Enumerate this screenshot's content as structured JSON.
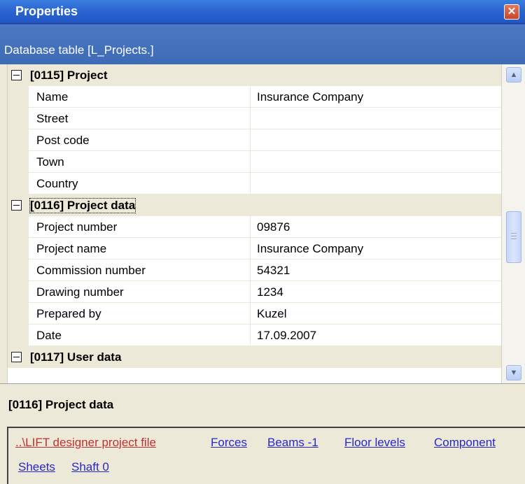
{
  "window": {
    "title": "Properties",
    "close_icon": "close-icon"
  },
  "header": {
    "subtitle": "Database table [L_Projects.]"
  },
  "grid": {
    "categories": [
      {
        "label": "[0115] Project",
        "properties": [
          {
            "name": "Name",
            "value": "Insurance Company"
          },
          {
            "name": "Street",
            "value": ""
          },
          {
            "name": "Post code",
            "value": ""
          },
          {
            "name": "Town",
            "value": ""
          },
          {
            "name": "Country",
            "value": ""
          }
        ]
      },
      {
        "label": "[0116] Project data",
        "properties": [
          {
            "name": "Project number",
            "value": "09876"
          },
          {
            "name": "Project name",
            "value": "Insurance Company"
          },
          {
            "name": "Commission number",
            "value": "54321"
          },
          {
            "name": "Drawing number",
            "value": "1234"
          },
          {
            "name": "Prepared by",
            "value": "Kuzel"
          },
          {
            "name": "Date",
            "value": "17.09.2007"
          }
        ]
      },
      {
        "label": "[0117] User data",
        "properties": []
      }
    ]
  },
  "description": {
    "title": "[0116] Project data"
  },
  "links": {
    "file": "..\\LIFT designer project file",
    "forces": "Forces",
    "beams": "Beams -1",
    "floor_levels": "Floor levels",
    "component": "Component",
    "sheets": "Sheets",
    "shaft": "Shaft 0"
  }
}
